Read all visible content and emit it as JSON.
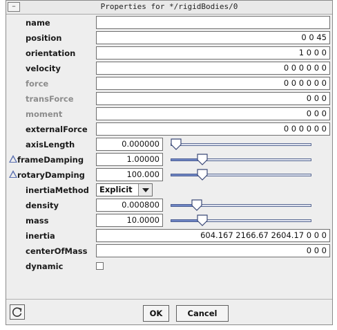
{
  "window": {
    "title": "Properties for */rigidBodies/0"
  },
  "properties": [
    {
      "label": "name",
      "value": "",
      "kind": "text"
    },
    {
      "label": "position",
      "value": "0 0 45",
      "kind": "text"
    },
    {
      "label": "orientation",
      "value": "1 0 0 0",
      "kind": "text"
    },
    {
      "label": "velocity",
      "value": "0 0 0 0 0 0",
      "kind": "text"
    },
    {
      "label": "force",
      "value": "0 0 0 0 0 0",
      "kind": "text",
      "disabled": true
    },
    {
      "label": "transForce",
      "value": "0 0 0",
      "kind": "text",
      "disabled": true
    },
    {
      "label": "moment",
      "value": "0 0 0",
      "kind": "text",
      "disabled": true
    },
    {
      "label": "externalForce",
      "value": "0 0 0 0 0 0",
      "kind": "text"
    },
    {
      "label": "axisLength",
      "value": "0.000000",
      "kind": "slider",
      "slider_fraction": 0.0
    },
    {
      "label": "frameDamping",
      "value": "1.00000",
      "kind": "slider",
      "slider_fraction": 0.2,
      "inherited": true
    },
    {
      "label": "rotaryDamping",
      "value": "100.000",
      "kind": "slider",
      "slider_fraction": 0.2,
      "inherited": true
    },
    {
      "label": "inertiaMethod",
      "value": "Explicit",
      "kind": "select"
    },
    {
      "label": "density",
      "value": "0.000800",
      "kind": "slider",
      "slider_fraction": 0.16
    },
    {
      "label": "mass",
      "value": "10.0000",
      "kind": "slider",
      "slider_fraction": 0.2
    },
    {
      "label": "inertia",
      "value": "604.167 2166.67 2604.17 0 0 0",
      "kind": "text"
    },
    {
      "label": "centerOfMass",
      "value": "0 0 0",
      "kind": "text"
    },
    {
      "label": "dynamic",
      "value": "",
      "kind": "checkbox",
      "checked": false
    }
  ],
  "buttons": {
    "ok_label": "OK",
    "cancel_label": "Cancel"
  },
  "icons": {
    "window_menu": "window-menu-icon",
    "inherited": "triangle-inherit-icon",
    "refresh": "refresh-icon",
    "dropdown": "chevron-down-icon"
  },
  "colors": {
    "slider_fill": "#6f86c4",
    "slider_track": "#dfe3ef",
    "inherit_triangle": "#5a6fb0",
    "disabled_label": "#8c8c8c"
  }
}
